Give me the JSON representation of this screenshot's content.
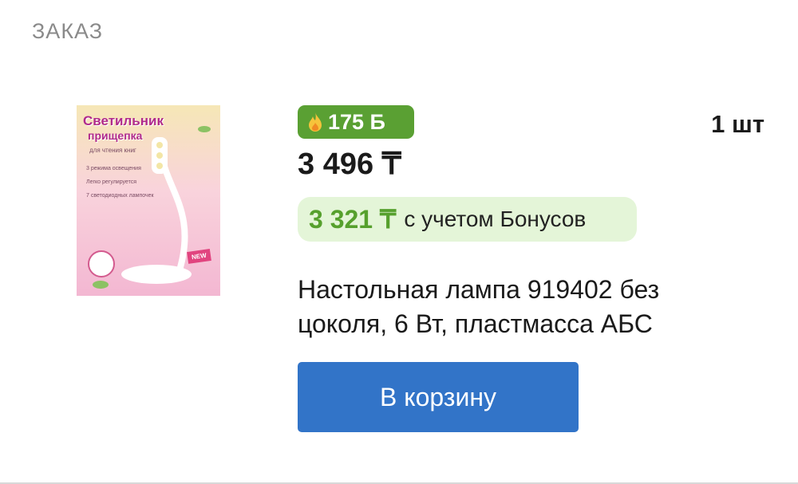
{
  "section": {
    "title": "ЗАКАЗ"
  },
  "product": {
    "image": {
      "alt_icon": "lamp-product-photo",
      "title_line1": "Светильник",
      "title_line2": "прищепка",
      "subtitle": "для чтения книг",
      "features": [
        "3 режима освещения",
        "Легко регулируется",
        "7 светодиодных лампочек"
      ],
      "new_label": "NEW"
    },
    "bonus_points": "175 Б",
    "price": "3 496 ₸",
    "quantity": "1 шт",
    "bonus_price": "3 321 ₸",
    "bonus_price_label": "с учетом Бонусов",
    "name": "Настольная лампа 919402 без цоколя, 6 Вт, пластмасса АБС",
    "cart_button_label": "В корзину"
  },
  "colors": {
    "accent_green": "#5aa033",
    "bonus_pill_bg": "#e4f5d8",
    "button_blue": "#3274c8"
  }
}
